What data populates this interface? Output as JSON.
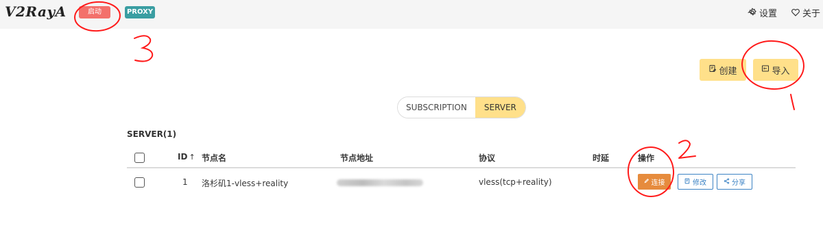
{
  "navbar": {
    "logo": "V2RayA",
    "start_label": "启动",
    "proxy_label": "PROXY",
    "settings_label": "设置",
    "about_label": "关于",
    "settings_icon": "gear-icon",
    "about_icon": "heart-icon"
  },
  "actions": {
    "create_label": "创建",
    "import_label": "导入",
    "create_icon": "create-icon",
    "import_icon": "import-icon"
  },
  "tabs": [
    {
      "label": "SUBSCRIPTION",
      "active": false
    },
    {
      "label": "SERVER",
      "active": true
    }
  ],
  "server_table": {
    "title": "SERVER(1)",
    "columns": {
      "id": "ID",
      "name": "节点名",
      "address": "节点地址",
      "protocol": "协议",
      "latency": "时延",
      "actions": "操作"
    },
    "sort_indicator": "↑",
    "rows": [
      {
        "id": "1",
        "name": "洛杉矶1-vless+reality",
        "address": "",
        "protocol": "vless(tcp+reality)",
        "latency": "",
        "connect_label": "连接",
        "edit_label": "修改",
        "share_label": "分享"
      }
    ]
  },
  "annotations": {
    "numbers": [
      "3",
      "1",
      "2"
    ],
    "color": "#ff1a1a"
  },
  "colors": {
    "navbar_bg": "#f5f5f5",
    "start_tag": "#f3706b",
    "proxy_tag": "#3a9ea2",
    "accent_yellow": "#ffe08a",
    "connect_orange": "#e68b3d",
    "outline_blue": "#3b82c4"
  }
}
